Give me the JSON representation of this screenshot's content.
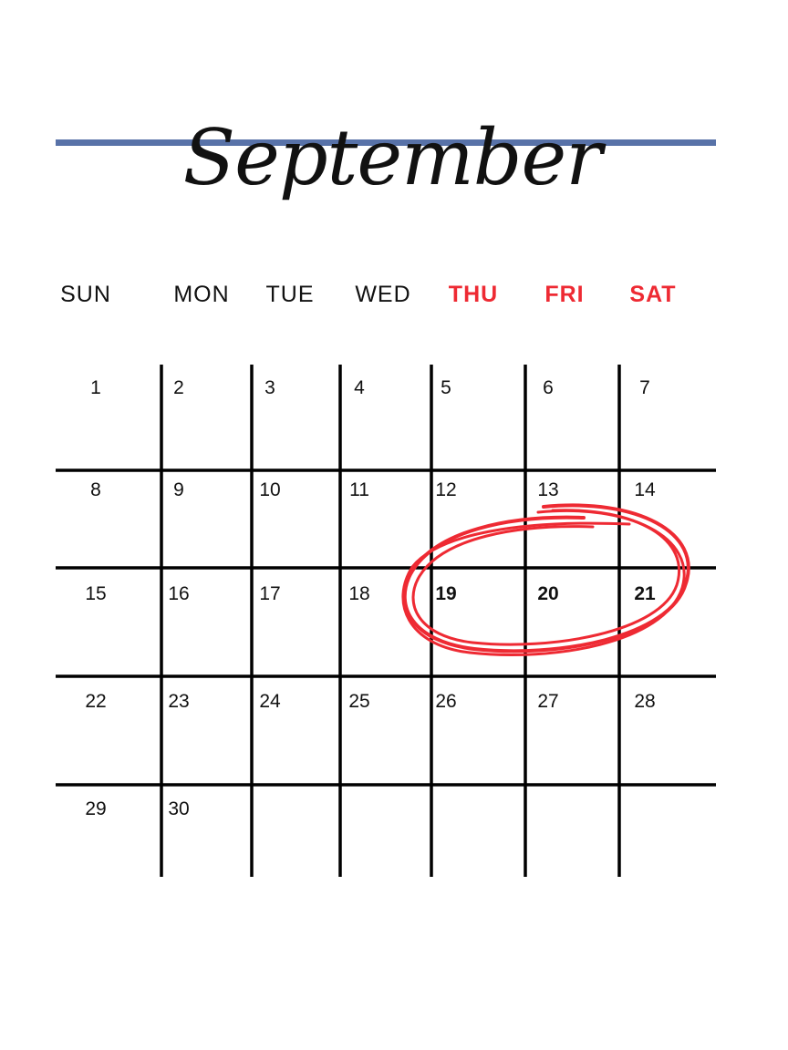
{
  "calendar": {
    "month": "September",
    "weekdays": [
      {
        "label": "SUN",
        "weekend": false
      },
      {
        "label": "MON",
        "weekend": false
      },
      {
        "label": "TUE",
        "weekend": false
      },
      {
        "label": "WED",
        "weekend": false
      },
      {
        "label": "THU",
        "weekend": true
      },
      {
        "label": "FRI",
        "weekend": true
      },
      {
        "label": "SAT",
        "weekend": true
      }
    ],
    "first_weekday_index": 0,
    "days_in_month": 30,
    "highlighted_days": [
      "19",
      "20",
      "21"
    ],
    "days": [
      "1",
      "2",
      "3",
      "4",
      "5",
      "6",
      "7",
      "8",
      "9",
      "10",
      "11",
      "12",
      "13",
      "14",
      "15",
      "16",
      "17",
      "18",
      "19",
      "20",
      "21",
      "22",
      "23",
      "24",
      "25",
      "26",
      "27",
      "28",
      "29",
      "30"
    ]
  },
  "colors": {
    "rule": "#5872a8",
    "accent_red": "#ee2a33",
    "text": "#111111",
    "grid_lines": "#000000"
  }
}
